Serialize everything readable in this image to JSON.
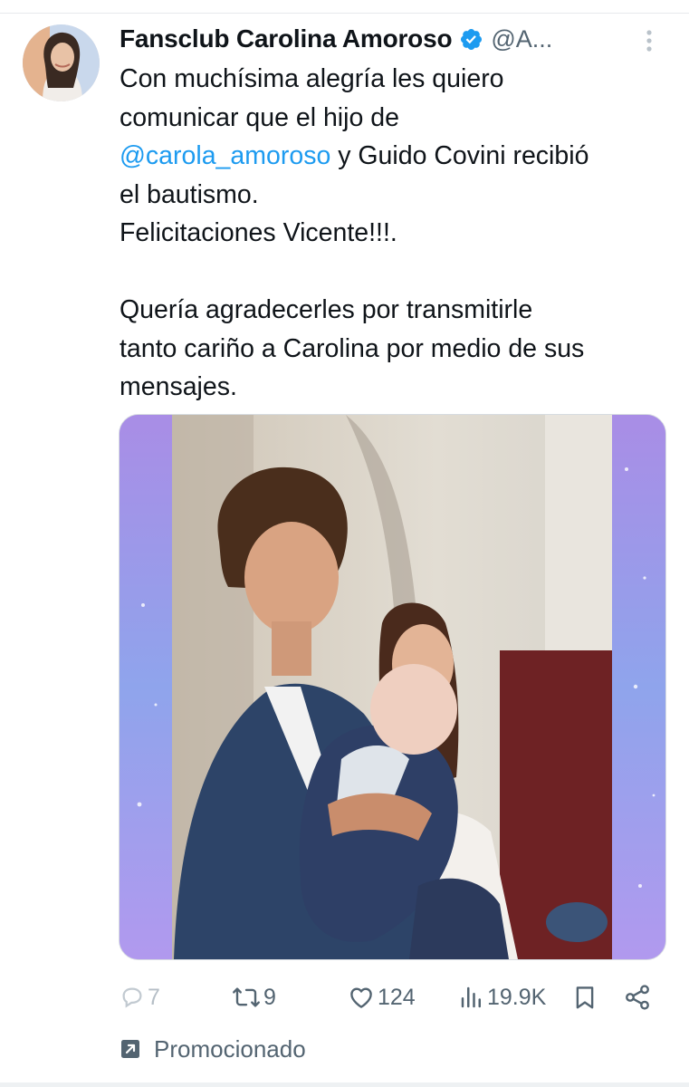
{
  "tweet": {
    "author": {
      "display_name": "Fansclub Carolina Amoroso",
      "handle": "@A...",
      "verified": true,
      "verified_color": "#1d9bf0"
    },
    "text": {
      "line1": "Con muchísima alegría les quiero",
      "line2": "comunicar que el hijo de",
      "mention": "@carola_amoroso",
      "after_mention": " y Guido Covini recibió",
      "line4": "el bautismo.",
      "line5": "Felicitaciones Vicente!!!.",
      "line7": "Quería agradecerles por transmitirle",
      "line8": "tanto cariño a Carolina por medio de sus",
      "line9": "mensajes."
    },
    "media": {
      "kind": "photo",
      "frame_color": "#9aa0ea"
    },
    "metrics": {
      "replies": "7",
      "reposts": "9",
      "likes": "124",
      "views": "19.9K"
    },
    "promoted_label": "Promocionado",
    "icons": {
      "reply": "reply-icon",
      "repost": "repost-icon",
      "like": "like-icon",
      "views": "views-icon",
      "bookmark": "bookmark-icon",
      "share": "share-icon",
      "more": "more-icon",
      "promoted": "promoted-icon"
    },
    "colors": {
      "text": "#0f1419",
      "secondary": "#536471",
      "link": "#1d9bf0"
    }
  }
}
